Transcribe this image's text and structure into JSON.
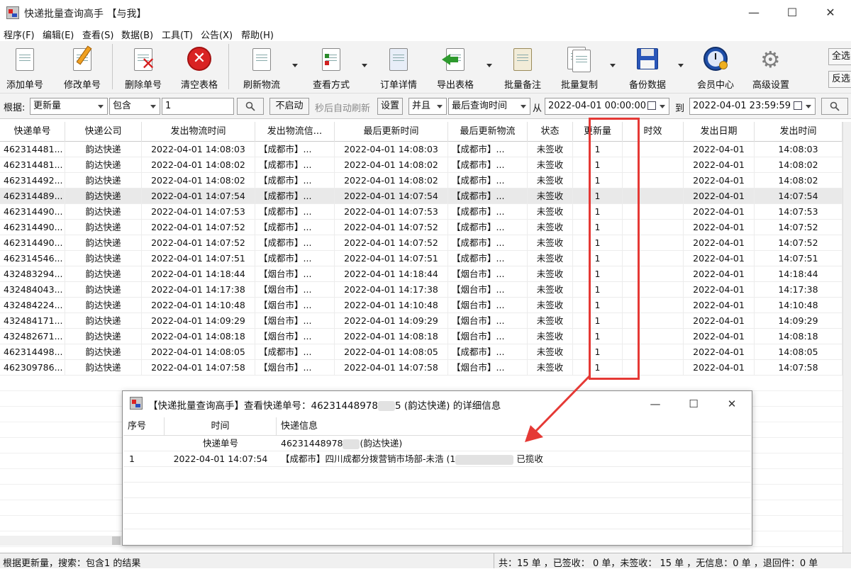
{
  "window": {
    "title": "快递批量查询高手 【与我】",
    "controls": [
      "—",
      "☐",
      "✕"
    ]
  },
  "menu": [
    "程序(F)",
    "编辑(E)",
    "查看(S)",
    "数据(B)",
    "工具(T)",
    "公告(X)",
    "帮助(H)"
  ],
  "toolbar": {
    "buttons": [
      {
        "label": "添加单号",
        "icon": "add-doc-icon"
      },
      {
        "label": "修改单号",
        "icon": "edit-pencil-icon"
      },
      {
        "label": "删除单号",
        "icon": "delete-doc-icon"
      },
      {
        "label": "清空表格",
        "icon": "clear-x-icon"
      },
      {
        "label": "刷新物流",
        "icon": "refresh-doc-icon"
      },
      {
        "label": "查看方式",
        "icon": "view-mode-icon"
      },
      {
        "label": "订单详情",
        "icon": "order-detail-icon"
      },
      {
        "label": "导出表格",
        "icon": "export-arrow-icon"
      },
      {
        "label": "批量备注",
        "icon": "note-scroll-icon"
      },
      {
        "label": "批量复制",
        "icon": "copy-docs-icon"
      },
      {
        "label": "备份数据",
        "icon": "floppy-icon"
      },
      {
        "label": "会员中心",
        "icon": "clock-user-icon"
      },
      {
        "label": "高级设置",
        "icon": "gear-icon"
      }
    ],
    "side_buttons": [
      "全选",
      "反选"
    ]
  },
  "filter": {
    "label_basis": "根据:",
    "field": "更新量",
    "op": "包含",
    "value": "1",
    "autorefresh_button": "不启动",
    "autorefresh_label": "秒后自动刷新",
    "set_button": "设置",
    "logic": "并且",
    "time_field": "最后查询时间",
    "from_label": "从",
    "from": "2022-04-01 00:00:00",
    "to_label": "到",
    "to": "2022-04-01 23:59:59"
  },
  "table": {
    "columns": [
      "快递单号",
      "快递公司",
      "发出物流时间",
      "发出物流信...",
      "最后更新时间",
      "最后更新物流",
      "状态",
      "更新量",
      "时效",
      "发出日期",
      "发出时间"
    ],
    "rows": [
      [
        "462314481...",
        "韵达快递",
        "2022-04-01 14:08:03",
        "【成都市】...",
        "2022-04-01 14:08:03",
        "【成都市】...",
        "未签收",
        "1",
        "",
        "2022-04-01",
        "14:08:03"
      ],
      [
        "462314481...",
        "韵达快递",
        "2022-04-01 14:08:02",
        "【成都市】...",
        "2022-04-01 14:08:02",
        "【成都市】...",
        "未签收",
        "1",
        "",
        "2022-04-01",
        "14:08:02"
      ],
      [
        "462314492...",
        "韵达快递",
        "2022-04-01 14:08:02",
        "【成都市】...",
        "2022-04-01 14:08:02",
        "【成都市】...",
        "未签收",
        "1",
        "",
        "2022-04-01",
        "14:08:02"
      ],
      [
        "462314489...",
        "韵达快递",
        "2022-04-01 14:07:54",
        "【成都市】...",
        "2022-04-01 14:07:54",
        "【成都市】...",
        "未签收",
        "1",
        "",
        "2022-04-01",
        "14:07:54"
      ],
      [
        "462314490...",
        "韵达快递",
        "2022-04-01 14:07:53",
        "【成都市】...",
        "2022-04-01 14:07:53",
        "【成都市】...",
        "未签收",
        "1",
        "",
        "2022-04-01",
        "14:07:53"
      ],
      [
        "462314490...",
        "韵达快递",
        "2022-04-01 14:07:52",
        "【成都市】...",
        "2022-04-01 14:07:52",
        "【成都市】...",
        "未签收",
        "1",
        "",
        "2022-04-01",
        "14:07:52"
      ],
      [
        "462314490...",
        "韵达快递",
        "2022-04-01 14:07:52",
        "【成都市】...",
        "2022-04-01 14:07:52",
        "【成都市】...",
        "未签收",
        "1",
        "",
        "2022-04-01",
        "14:07:52"
      ],
      [
        "462314546...",
        "韵达快递",
        "2022-04-01 14:07:51",
        "【成都市】...",
        "2022-04-01 14:07:51",
        "【成都市】...",
        "未签收",
        "1",
        "",
        "2022-04-01",
        "14:07:51"
      ],
      [
        "432483294...",
        "韵达快递",
        "2022-04-01 14:18:44",
        "【烟台市】...",
        "2022-04-01 14:18:44",
        "【烟台市】...",
        "未签收",
        "1",
        "",
        "2022-04-01",
        "14:18:44"
      ],
      [
        "432484043...",
        "韵达快递",
        "2022-04-01 14:17:38",
        "【烟台市】...",
        "2022-04-01 14:17:38",
        "【烟台市】...",
        "未签收",
        "1",
        "",
        "2022-04-01",
        "14:17:38"
      ],
      [
        "432484224...",
        "韵达快递",
        "2022-04-01 14:10:48",
        "【烟台市】...",
        "2022-04-01 14:10:48",
        "【烟台市】...",
        "未签收",
        "1",
        "",
        "2022-04-01",
        "14:10:48"
      ],
      [
        "432484171...",
        "韵达快递",
        "2022-04-01 14:09:29",
        "【烟台市】...",
        "2022-04-01 14:09:29",
        "【烟台市】...",
        "未签收",
        "1",
        "",
        "2022-04-01",
        "14:09:29"
      ],
      [
        "432482671...",
        "韵达快递",
        "2022-04-01 14:08:18",
        "【烟台市】...",
        "2022-04-01 14:08:18",
        "【烟台市】...",
        "未签收",
        "1",
        "",
        "2022-04-01",
        "14:08:18"
      ],
      [
        "462314498...",
        "韵达快递",
        "2022-04-01 14:08:05",
        "【成都市】...",
        "2022-04-01 14:08:05",
        "【成都市】...",
        "未签收",
        "1",
        "",
        "2022-04-01",
        "14:08:05"
      ],
      [
        "462309786...",
        "韵达快递",
        "2022-04-01 14:07:58",
        "【烟台市】...",
        "2022-04-01 14:07:58",
        "【烟台市】...",
        "未签收",
        "1",
        "",
        "2022-04-01",
        "14:07:58"
      ]
    ],
    "selected_row": 3
  },
  "status": {
    "left": "根据更新量，搜索：包含1 的结果",
    "right": "共：15 单 ，已签收： 0 单，未签收： 15 单 ，无信息：0 单 ，退回件：0 单"
  },
  "dialog": {
    "title_prefix": "【快递批量查询高手】查看快递单号：46231448978",
    "title_suffix": "5 (韵达快递) 的详细信息",
    "controls": [
      "—",
      "☐",
      "✕"
    ],
    "columns": [
      "序号",
      "时间",
      "快递信息"
    ],
    "sub_label": "快递单号",
    "sub_value_prefix": "46231448978",
    "sub_value_suffix": "(韵达快递)",
    "row_index": "1",
    "row_time": "2022-04-01 14:07:54",
    "row_info_prefix": "【成都市】四川成都分拨营销市场部-未浩 (1",
    "row_info_suffix": "已揽收"
  },
  "colors": {
    "highlight_red": "#e53935",
    "arrow_red": "#e53935"
  }
}
